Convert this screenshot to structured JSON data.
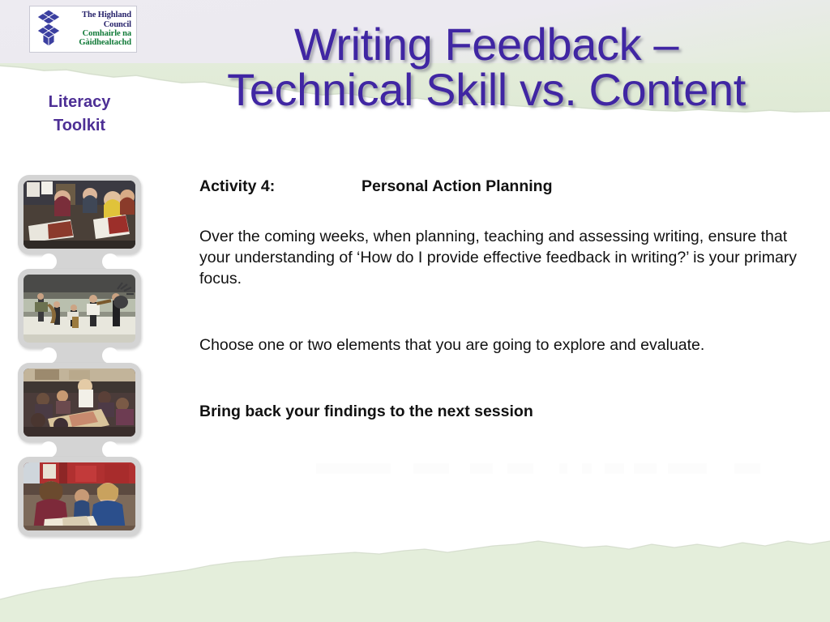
{
  "slide": {
    "background_color": "#ffffff",
    "band_top_color": "#eceaf0",
    "band_green_color": "#e2ecd8",
    "accent_purple": "#4026a3",
    "toolkit_purple": "#4d2f95",
    "filmstrip_gray": "#d4d4d4"
  },
  "logo": {
    "name": "highland-council-logo",
    "lines_en": [
      "The Highland",
      "Council"
    ],
    "lines_gd": [
      "Comhairle na",
      "Gàidhealtachd"
    ],
    "color_en": "#27236b",
    "color_gd": "#117a38",
    "emblem": "triangular-lattice-emblem"
  },
  "toolkit": {
    "line1": "Literacy",
    "line2": "Toolkit"
  },
  "title": {
    "line1": "Writing Feedback –",
    "line2": "Technical Skill vs. Content",
    "color": "#4026a3"
  },
  "activity": {
    "label": "Activity 4:",
    "value": "Personal Action Planning"
  },
  "body": {
    "paragraph1": "Over the coming weeks, when planning, teaching and assessing writing, ensure that your understanding of ‘How do I provide effective feedback in writing?’ is your primary focus.",
    "paragraph2": "Choose one or two elements that you are going to explore and evaluate.",
    "paragraph3": "Bring back your findings to the next session"
  },
  "filmstrip": {
    "name": "photo-filmstrip",
    "frames": [
      {
        "caption": "pupils-reading-magazines-in-class"
      },
      {
        "caption": "pupils-playing-traditional-instruments-outdoors"
      },
      {
        "caption": "classroom-overhead-group-working"
      },
      {
        "caption": "teacher-helping-pupils-with-books"
      }
    ]
  }
}
